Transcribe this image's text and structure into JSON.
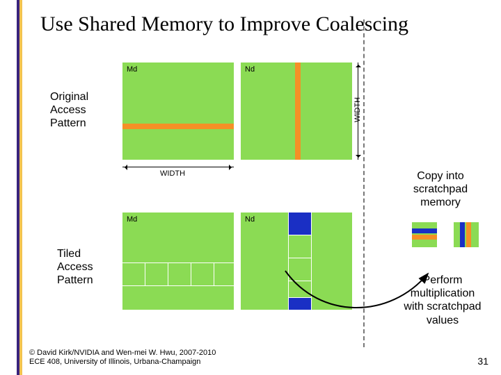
{
  "title": "Use Shared Memory to Improve Coalescing",
  "top": {
    "md_label": "Md",
    "nd_label": "Nd",
    "width_label_h": "WIDTH",
    "width_label_v": "WIDTH"
  },
  "left_caption_top": "Original\nAccess\nPattern",
  "left_caption_bottom": "Tiled\nAccess\nPattern",
  "bottom": {
    "md_label": "Md",
    "nd_label": "Nd"
  },
  "right_note_top": "Copy into\nscratchpad\nmemory",
  "right_note_bottom": "Perform\nmultiplication\nwith scratchpad\nvalues",
  "footer_line1": "© David Kirk/NVIDIA and Wen-mei W. Hwu, 2007-2010",
  "footer_line2": "ECE 408, University of Illinois, Urbana-Champaign",
  "page_number": "31"
}
